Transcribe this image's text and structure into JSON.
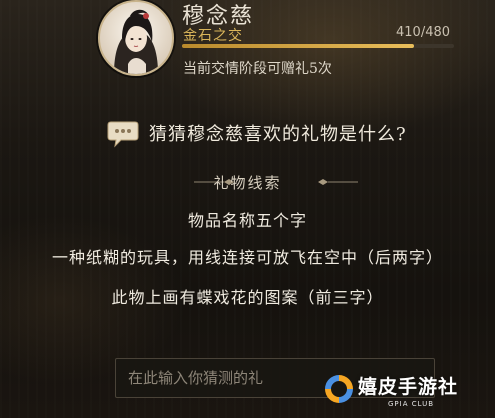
{
  "character": {
    "name": "穆念慈",
    "relation_level": "金石之交",
    "affinity_current": 410,
    "affinity_max": 480,
    "affinity_text": "410/480",
    "gift_info": "当前交情阶段可赠礼5次",
    "avatar_icon": "character-portrait"
  },
  "question": {
    "text": "猜猜穆念慈喜欢的礼物是什么?",
    "icon": "speech-bubble-icon"
  },
  "clues": {
    "header": "礼物线索",
    "items": [
      "物品名称五个字",
      "一种纸糊的玩具，用线连接可放飞在空中（后两字）",
      "此物上画有蝶戏花的图案（前三字）"
    ]
  },
  "answer_input": {
    "placeholder": "在此输入你猜测的礼",
    "value": ""
  },
  "watermark": {
    "text": "嬉皮手游社",
    "subtext": "GPIA CLUB"
  },
  "colors": {
    "gold": "#d9b55a",
    "progress": "#e9be5b",
    "text": "#efe9dc"
  }
}
